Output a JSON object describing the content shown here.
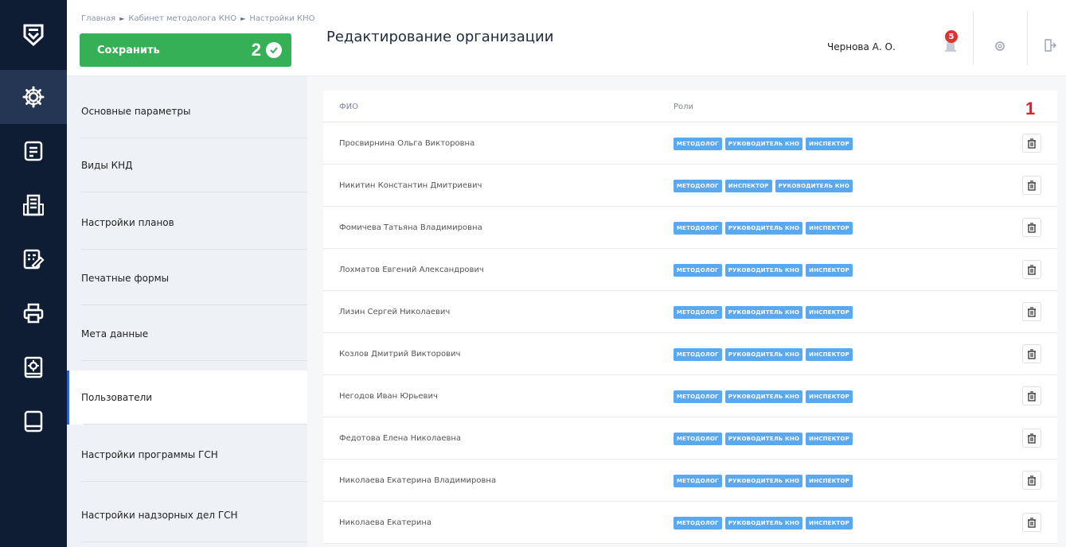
{
  "breadcrumbs": [
    "Главная",
    "Кабинет методолога КНО",
    "Настройки КНО"
  ],
  "save_button": {
    "label": "Сохранить",
    "marker": "2"
  },
  "page_title": "Редактирование организации",
  "user": {
    "name": "Чернова А. О."
  },
  "notifications": {
    "count": "5"
  },
  "delete_marker": "1",
  "submenu": [
    "Основные параметры",
    "Виды КНД",
    "Настройки планов",
    "Печатные формы",
    "Мета данные",
    "Пользователи",
    "Настройки программы ГСН",
    "Настройки надзорных дел ГСН"
  ],
  "submenu_active": "Пользователи",
  "rail_icons": [
    "logo-shield-icon",
    "gear-icon",
    "document-icon",
    "building-icon",
    "checklist-edit-icon",
    "printer-icon",
    "book-settings-icon",
    "book-icon"
  ],
  "table": {
    "columns": [
      "ФИО",
      "Роли"
    ],
    "rows": [
      {
        "fio": "Просвирнина Ольга Викторовна",
        "roles": [
          "МЕТОДОЛОГ",
          "РУКОВОДИТЕЛЬ КНО",
          "ИНСПЕКТОР"
        ]
      },
      {
        "fio": "Никитин Константин Дмитриевич",
        "roles": [
          "МЕТОДОЛОГ",
          "ИНСПЕКТОР",
          "РУКОВОДИТЕЛЬ КНО"
        ]
      },
      {
        "fio": "Фомичева Татьяна Владимировна",
        "roles": [
          "МЕТОДОЛОГ",
          "РУКОВОДИТЕЛЬ КНО",
          "ИНСПЕКТОР"
        ]
      },
      {
        "fio": "Лохматов Евгений Александрович",
        "roles": [
          "МЕТОДОЛОГ",
          "РУКОВОДИТЕЛЬ КНО",
          "ИНСПЕКТОР"
        ]
      },
      {
        "fio": "Лизин Сергей Николаевич",
        "roles": [
          "МЕТОДОЛОГ",
          "РУКОВОДИТЕЛЬ КНО",
          "ИНСПЕКТОР"
        ]
      },
      {
        "fio": "Козлов Дмитрий Викторович",
        "roles": [
          "МЕТОДОЛОГ",
          "РУКОВОДИТЕЛЬ КНО",
          "ИНСПЕКТОР"
        ]
      },
      {
        "fio": "Негодов Иван Юрьевич",
        "roles": [
          "МЕТОДОЛОГ",
          "РУКОВОДИТЕЛЬ КНО",
          "ИНСПЕКТОР"
        ]
      },
      {
        "fio": "Федотова Елена Николаевна",
        "roles": [
          "МЕТОДОЛОГ",
          "РУКОВОДИТЕЛЬ КНО",
          "ИНСПЕКТОР"
        ]
      },
      {
        "fio": "Николаева Екатерина Владимировна",
        "roles": [
          "МЕТОДОЛОГ",
          "РУКОВОДИТЕЛЬ КНО",
          "ИНСПЕКТОР"
        ]
      },
      {
        "fio": "Николаева Екатерина",
        "roles": [
          "МЕТОДОЛОГ",
          "РУКОВОДИТЕЛЬ КНО",
          "ИНСПЕКТОР"
        ]
      }
    ]
  },
  "colors": {
    "rail": "#0e1d33",
    "save": "#36b056",
    "role_tag": "#5aa8f0",
    "marker": "#d8232a",
    "badge": "#e03131"
  }
}
